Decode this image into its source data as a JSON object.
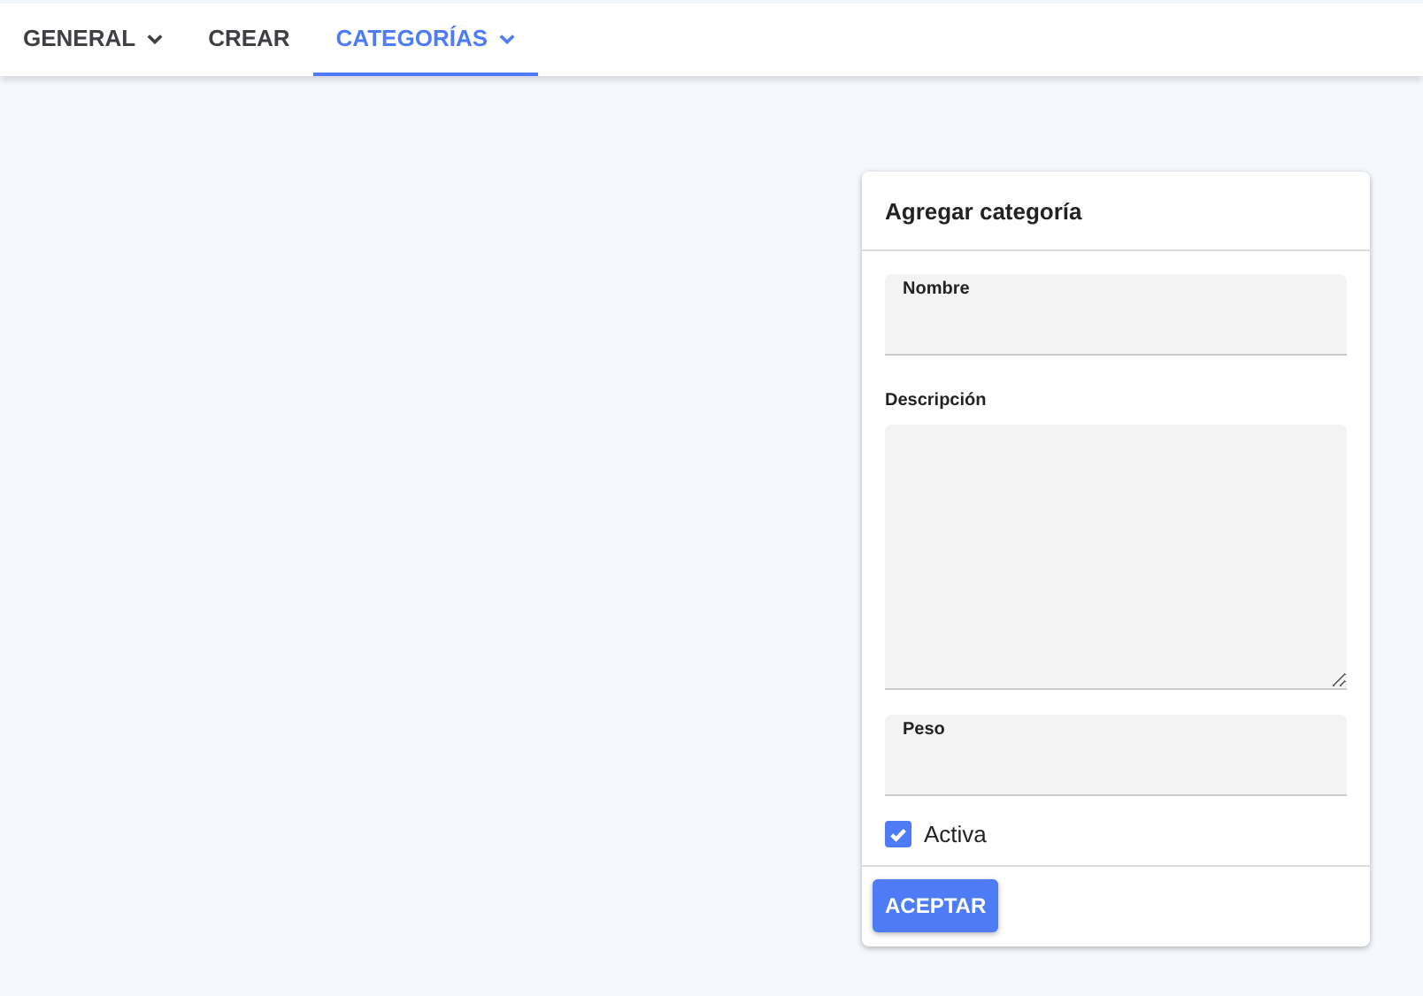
{
  "tabs": [
    {
      "label": "GENERAL",
      "selected": false,
      "dropdown": true
    },
    {
      "label": "CREAR",
      "selected": false,
      "dropdown": false
    },
    {
      "label": "CATEGORÍAS",
      "selected": true,
      "dropdown": true
    }
  ],
  "card": {
    "title": "Agregar categoría",
    "fields": [
      {
        "kind": "input",
        "label": "Nombre"
      },
      {
        "kind": "textarea",
        "label": "Descripción"
      },
      {
        "kind": "input",
        "label": "Peso"
      }
    ],
    "checkbox": {
      "label": "Activa",
      "checked": true
    },
    "button": "ACEPTAR"
  }
}
